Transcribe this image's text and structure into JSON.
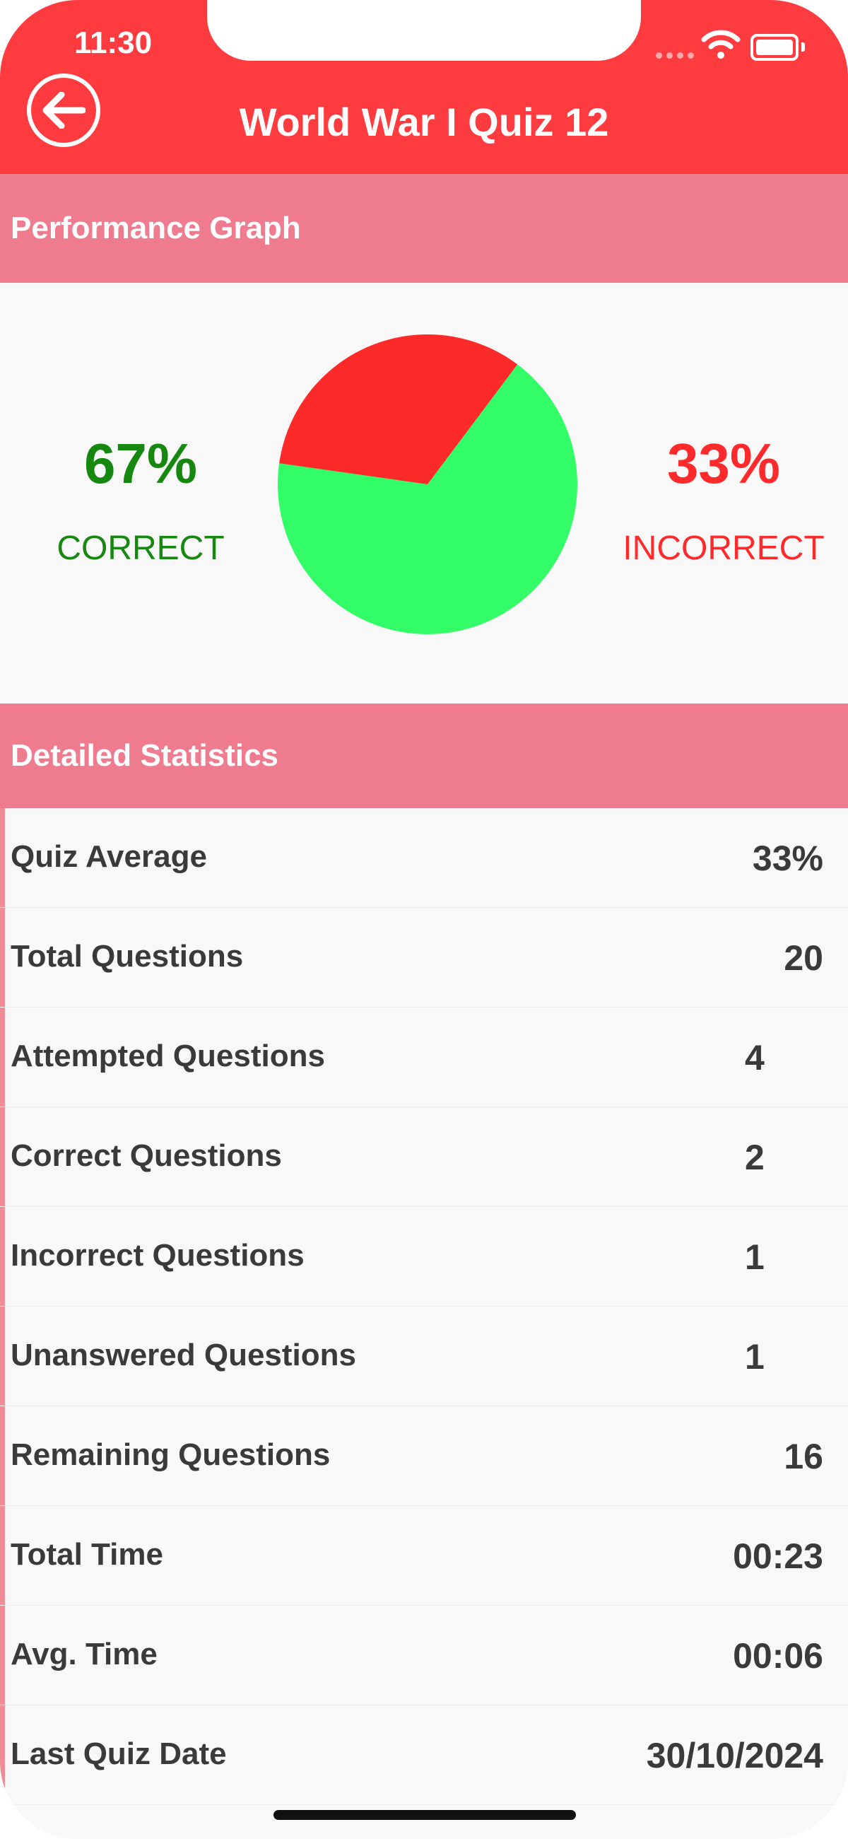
{
  "status_bar": {
    "time": "11:30"
  },
  "header": {
    "title": "World War I Quiz 12",
    "back_icon": "arrow-left-circle-icon"
  },
  "colors": {
    "header": "#fe3b3f",
    "section": "#ef7b8f",
    "correct": "#16870f",
    "incorrect": "#ff2a2c",
    "pie_correct": "#33fd66",
    "pie_incorrect": "#fd2a2a"
  },
  "performance": {
    "section_title": "Performance Graph",
    "correct_percent": "67%",
    "correct_label": "CORRECT",
    "incorrect_percent": "33%",
    "incorrect_label": "INCORRECT"
  },
  "chart_data": {
    "type": "pie",
    "categories": [
      "Correct",
      "Incorrect"
    ],
    "values": [
      67,
      33
    ]
  },
  "statistics": {
    "section_title": "Detailed Statistics",
    "rows": [
      {
        "label": "Quiz Average",
        "value": "33%"
      },
      {
        "label": "Total Questions",
        "value": "20"
      },
      {
        "label": "Attempted Questions",
        "value": "4"
      },
      {
        "label": "Correct Questions",
        "value": "2"
      },
      {
        "label": "Incorrect Questions",
        "value": "1"
      },
      {
        "label": "Unanswered Questions",
        "value": "1"
      },
      {
        "label": "Remaining Questions",
        "value": "16"
      },
      {
        "label": "Total Time",
        "value": "00:23"
      },
      {
        "label": "Avg. Time",
        "value": "00:06"
      },
      {
        "label": "Last Quiz Date",
        "value": "30/10/2024"
      }
    ]
  }
}
